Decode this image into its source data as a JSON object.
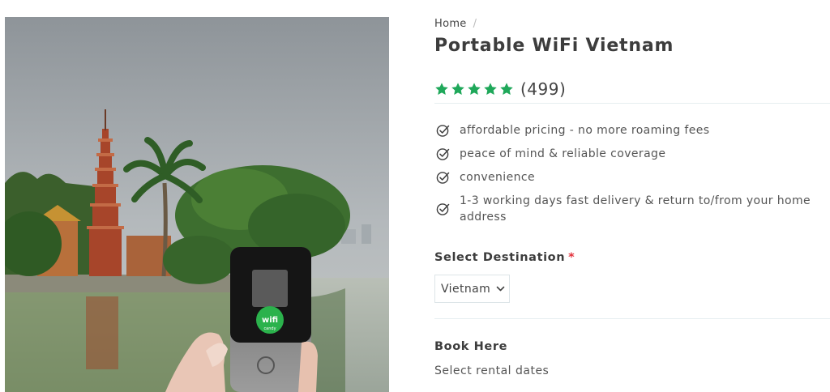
{
  "breadcrumb": {
    "home": "Home",
    "separator": "/"
  },
  "product": {
    "title": "Portable WiFi Vietnam",
    "rating_stars": 5,
    "rating_count": "(499)",
    "device_logo_text": "wifi",
    "device_logo_subtext": "candy"
  },
  "benefits": [
    {
      "icon": "check-circle-icon",
      "text": "affordable pricing - no more roaming fees"
    },
    {
      "icon": "check-circle-icon",
      "text": "peace of mind & reliable coverage"
    },
    {
      "icon": "check-circle-icon",
      "text": "convenience"
    },
    {
      "icon": "check-circle-icon",
      "text": "1-3 working days fast delivery & return to/from your home address"
    }
  ],
  "destination": {
    "label": "Select Destination",
    "required_mark": "*",
    "selected": "Vietnam"
  },
  "booking": {
    "title": "Book Here",
    "subtitle": "Select rental dates"
  },
  "colors": {
    "star": "#1fa85a",
    "required": "#e2303a",
    "text": "#3d3d3d",
    "device_logo": "#2bb24c"
  }
}
